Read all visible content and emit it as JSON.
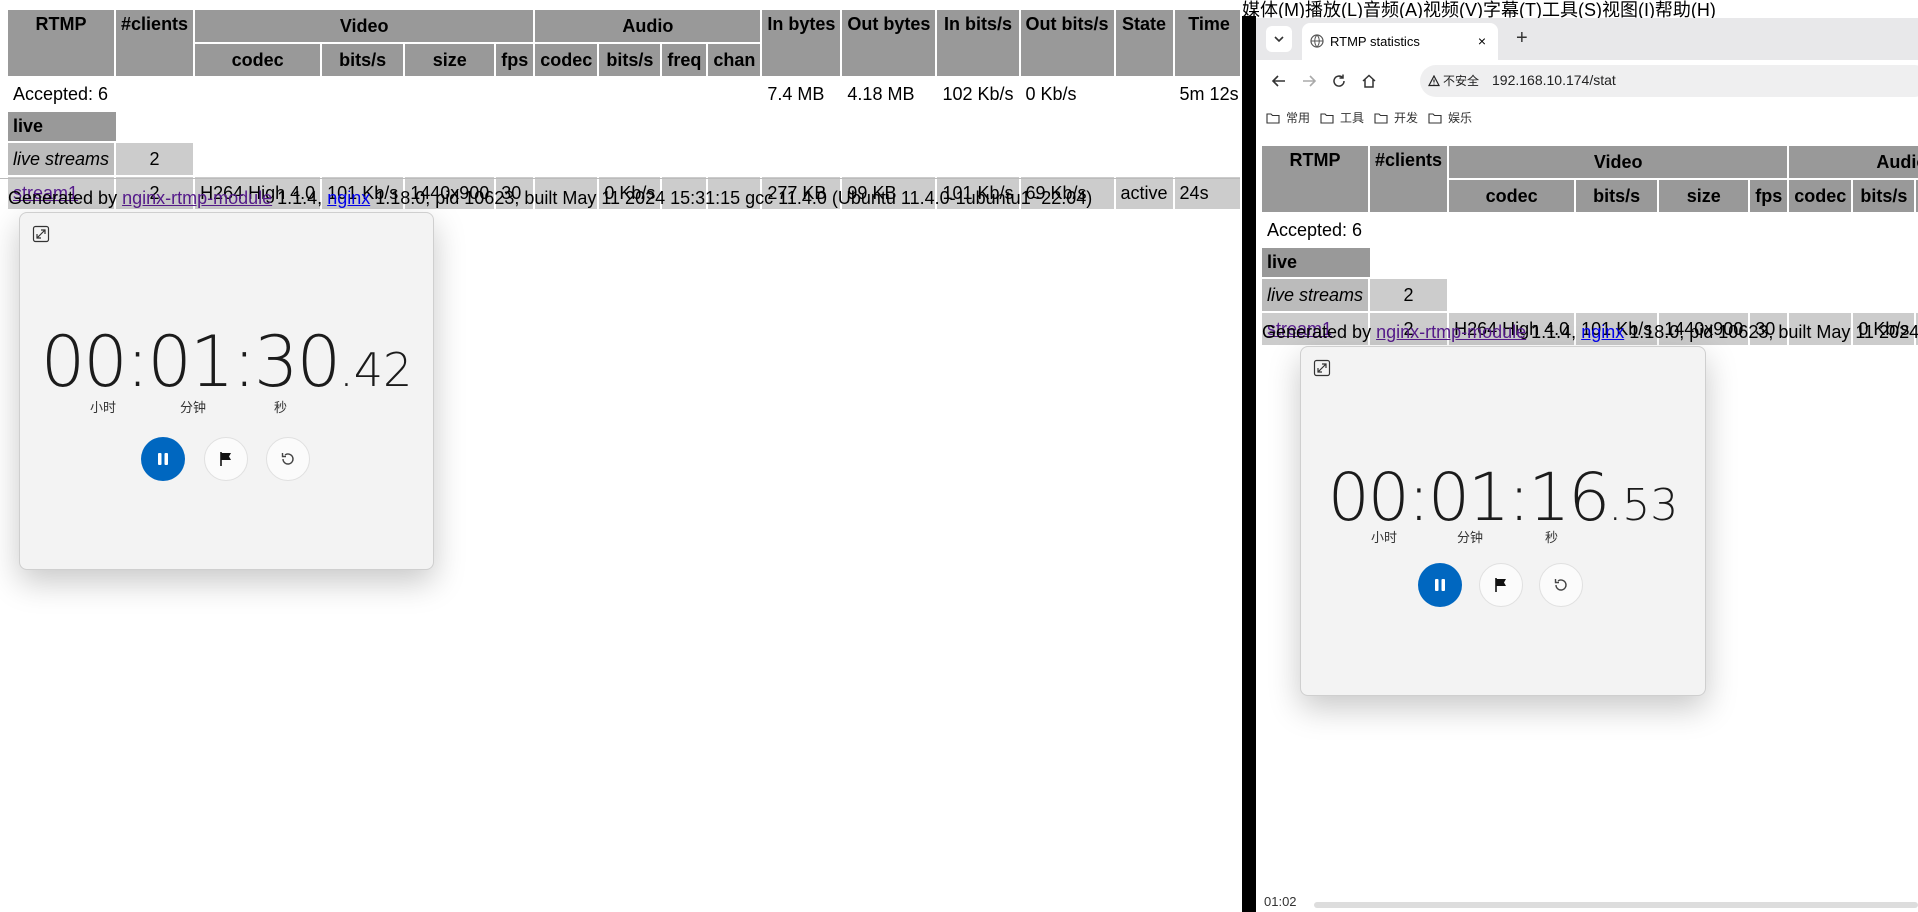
{
  "stat": {
    "headers": {
      "rtmp": "RTMP",
      "clients": "#clients",
      "video": "Video",
      "audio": "Audio",
      "in_bytes": "In bytes",
      "out_bytes": "Out bytes",
      "in_bits": "In bits/s",
      "out_bits": "Out bits/s",
      "state": "State",
      "time": "Time"
    },
    "subheaders": {
      "v_codec": "codec",
      "v_bits": "bits/s",
      "v_size": "size",
      "v_fps": "fps",
      "a_codec": "codec",
      "a_bits": "bits/s",
      "a_freq": "freq",
      "a_chan": "chan"
    },
    "summary": {
      "accepted": "Accepted: 6",
      "in_bytes": "7.4 MB",
      "out_bytes": "4.18 MB",
      "in_bits": "102 Kb/s",
      "out_bits": "0 Kb/s",
      "time": "5m 12s"
    },
    "app_name": "live",
    "live_streams_label": "live streams",
    "live_streams_count": "2",
    "stream": {
      "name": "stream1",
      "clients": "2",
      "v_codec": "H264 High 4.0",
      "v_bits": "101 Kb/s",
      "v_size": "1440x900",
      "v_fps": "30",
      "a_codec": "",
      "a_bits": "0 Kb/s",
      "a_freq": "",
      "a_chan": "",
      "in_bytes": "277 KB",
      "out_bytes": "99 KB",
      "in_bits": "101 Kb/s",
      "out_bits": "69 Kb/s",
      "state": "active",
      "time": "24s"
    },
    "generated": {
      "prefix": "Generated by ",
      "module_link": "nginx-rtmp-module",
      "mid1": " 1.1.4, ",
      "nginx_link": "nginx",
      "suffix": " 1.18.0, pid 10623, built May 11 2024 15:31:15 gcc 11.4.0 (Ubuntu 11.4.0-1ubuntu1~22.04)"
    }
  },
  "stopwatch_left": {
    "hours": "00",
    "minutes": "01",
    "seconds": "30",
    "hundredths": ".42",
    "unit_hours": "小时",
    "unit_minutes": "分钟",
    "unit_seconds": "秒"
  },
  "right_window": {
    "menu_bar": "媒体(M)播放(L)音频(A)视频(V)字幕(T)工具(S)视图(I)帮助(H)",
    "tab_title": "RTMP statistics",
    "tab_close": "×",
    "new_tab": "+",
    "security_label": "不安全",
    "url": "192.168.10.174/stat",
    "bookmarks": [
      "常用",
      "工具",
      "开发",
      "娱乐"
    ],
    "status_time": "01:02",
    "stopwatch": {
      "hours": "00",
      "minutes": "01",
      "seconds": "16",
      "hundredths": ".53",
      "unit_hours": "小时",
      "unit_minutes": "分钟",
      "unit_seconds": "秒"
    }
  },
  "colors": {
    "header_gray": "#999999",
    "row_gray": "#cccccc",
    "accent_blue": "#0067c0",
    "link_visited": "#551a8b"
  }
}
